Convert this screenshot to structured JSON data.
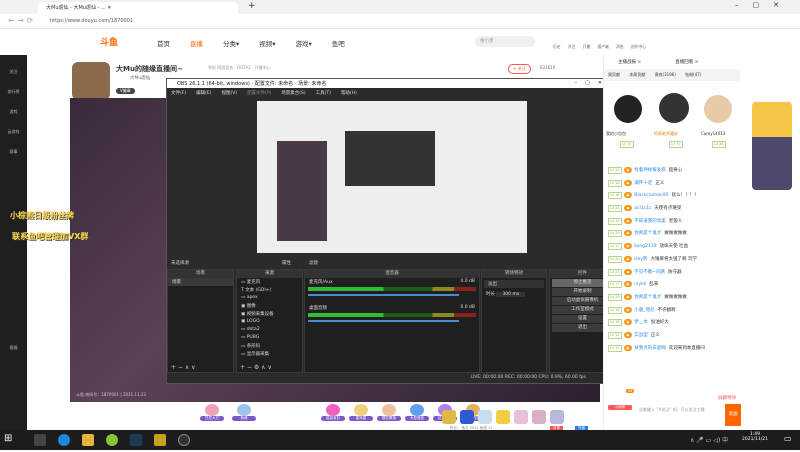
{
  "browser": {
    "tab_title": "大Mu虐仙 - 大Mu虐仙 - ...",
    "url": "https://www.douyu.com/1870001"
  },
  "site": {
    "logo": "斗鱼",
    "nav": [
      "首页",
      "直播",
      "分类▾",
      "视频▾",
      "游戏▾",
      "鱼吧"
    ],
    "search_placeholder": "搜小黑",
    "header_icons": [
      "历史",
      "关注",
      "开播",
      "客户端",
      "消息",
      "创作中心"
    ]
  },
  "sidebar": [
    "关注",
    "排行榜",
    "游戏",
    "云游戏",
    "赛事",
    "客服"
  ],
  "streamer": {
    "title": "大Mu的随缘直播间~",
    "meta": "举报 网游竞技 · DOTA2 · 开播中心",
    "name": "大Mu虐仙",
    "follow": "+ 关注",
    "fans": "631610",
    "badge": "V徽章"
  },
  "video": {
    "overlay_line1": "小棕熊日级粉丝牌",
    "overlay_line2": "联系鱼吧管理加VX群",
    "room_info": "斗鱼 房间号：1870001 | 2021.11.23"
  },
  "obs": {
    "title": "OBS 26.1.1 (64-bit, windows) - 配置文件: 未命名 - 场景: 未命名",
    "menu": [
      "文件(F)",
      "编辑(E)",
      "视图(V)",
      "配置文件(P)",
      "场景集合(S)",
      "工具(T)",
      "帮助(H)"
    ],
    "no_source": "未选择源",
    "properties": "属性",
    "filters": "滤镜",
    "scenes_header": "场景",
    "scenes": [
      "场景"
    ],
    "sources_header": "来源",
    "sources": [
      "麦克风",
      "文本 (GDI+)",
      "apex",
      "图像",
      "视频采集设备",
      "LOGO",
      "dota2",
      "PUBG",
      "条形码",
      "显示器采集"
    ],
    "mixer_header": "混音器",
    "mixer": [
      {
        "name": "麦克风/Aux",
        "db": "0.0 dB",
        "level": 0.45
      },
      {
        "name": "桌面音频",
        "db": "0.0 dB",
        "level": 0.33
      }
    ],
    "transitions_header": "转场特效",
    "transition": "淡出",
    "duration_label": "时长",
    "duration": "300 ms",
    "controls_header": "控件",
    "controls": [
      "停止推流",
      "开始录制",
      "启动虚拟摄像机",
      "工作室模式",
      "设置",
      "退出"
    ],
    "status": "LIVE: 00:00:00   REC: 00:00:00   CPU: 0.9%, 60.00 fps"
  },
  "chat": {
    "tabs": [
      "主播战报 >",
      "直播回看 >"
    ],
    "subtabs": [
      "周贡献",
      "本周贡献",
      "贵宾(3196)",
      "钻粉(47)"
    ],
    "top_users": [
      {
        "name": "我的小包包",
        "lv": "LV 30"
      },
      {
        "name": "柯雨老师骚好",
        "lv": "LV 37"
      },
      {
        "name": "Corey14013",
        "lv": "LV 28"
      }
    ],
    "messages": [
      {
        "lv": "LV 20",
        "user": "找着神样报发病",
        "text": "超奇心"
      },
      {
        "lv": "LV 18",
        "user": "满怀十足",
        "text": "正义"
      },
      {
        "lv": "LV 16",
        "user": "Blackcaiman95",
        "text": "就么！！！！"
      },
      {
        "lv": "LV 22",
        "user": "acl1c1c",
        "text": "天使有点难受"
      },
      {
        "lv": "LV 19",
        "user": "不知道我的温柔",
        "text": "老狼人"
      },
      {
        "lv": "LV 25",
        "user": "你真是个鬼才",
        "text": "做做做做做"
      },
      {
        "lv": "LV 17",
        "user": "kong2119",
        "text": "放纵天使 吐血"
      },
      {
        "lv": "LV 20",
        "user": "Hey熊",
        "text": "大锤麻将太强了啊 玩学"
      },
      {
        "lv": "LV 23",
        "user": "不见不散~同路",
        "text": "防守器"
      },
      {
        "lv": "LV 17",
        "user": "inykk",
        "text": "乱来"
      },
      {
        "lv": "LV 25",
        "user": "你真是个鬼才",
        "text": "做做做做做"
      },
      {
        "lv": "LV 14",
        "user": "小鹿_瑶尼",
        "text": "不许翻啊"
      },
      {
        "lv": "LV 18",
        "user": "伊__木",
        "text": "加油好大"
      },
      {
        "lv": "LV 15",
        "user": "实战型",
        "text": "正义"
      },
      {
        "lv": "LV 41",
        "user": "扶我点的去虐啊",
        "text": "欢迎来到本直播间"
      }
    ],
    "danmu_toggle": "屏蔽特效",
    "badge_count": "58",
    "input_placeholder": "说着输入 \"#关注\" 吧，可以关注主播",
    "send": "发送",
    "fans_medal": "小棕熊"
  },
  "gifts": {
    "labels": [
      "任意大方",
      "鱼情",
      "能量宝石",
      "星辉星",
      "樱花飘落",
      "大型魔盒",
      "钻石粉丝",
      "火箭炸弹"
    ],
    "stats": [
      "粉丝：",
      "鱼丸 3022",
      "鱼翅 11"
    ],
    "share": "分享",
    "charge": "充值"
  },
  "taskbar": {
    "time": "1:49",
    "date": "2021/11/21"
  }
}
